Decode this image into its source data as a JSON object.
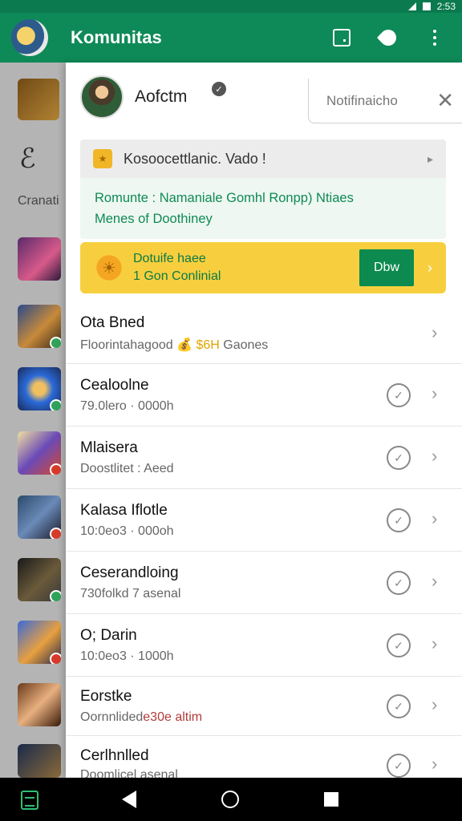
{
  "status_bar": {
    "time": "2:53"
  },
  "app": {
    "title": "Komunitas"
  },
  "background_list": {
    "label_1": "Cranati"
  },
  "profile": {
    "name": "Aofctm"
  },
  "notification": {
    "label": "Notifinaicho"
  },
  "announcement": {
    "title": "Kosoocettlanic. Vado !",
    "body_line1": "Romunte : Namaniale Gomhl Ronpp) Ntiaes",
    "body_line2": "Menes of Doothiney"
  },
  "promo": {
    "line1": "Dotuife haee",
    "line2": "1 Gon Conlinial",
    "button_label": "Dbw"
  },
  "rows": [
    {
      "title": "Ota Bned",
      "subtitle": "Floorintahagood",
      "gold": "💰 $6H",
      "suffix": "Gaones"
    },
    {
      "title": "Cealoolne",
      "subtitle": "79.0lero · 0000h"
    },
    {
      "title": "Mlaisera",
      "subtitle": "Doostlitet : Aeed"
    },
    {
      "title": "Kalasa Iflotle",
      "subtitle": "10:0eo3 · 000oh"
    },
    {
      "title": "Ceserandloing",
      "subtitle": "730folkd 7 asenal"
    },
    {
      "title": "O; Darin",
      "subtitle": "10:0eo3 · 1000h"
    },
    {
      "title": "Eorstke",
      "subtitle": "Oornnlided",
      "accent": "e30e altim"
    },
    {
      "title": "Cerlhnlled",
      "subtitle": "Doomlicel asenal"
    }
  ],
  "colors": {
    "primary": "#0e8a58",
    "status_bar": "#0b7a4e",
    "promo_bg": "#f7cf3e",
    "promo_button": "#0c8a4f",
    "announce_text": "#0f8a55"
  }
}
